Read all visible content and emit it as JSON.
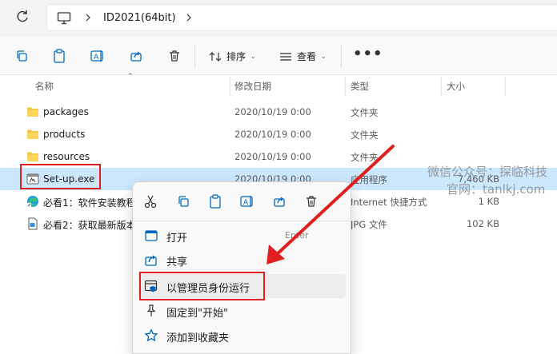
{
  "address": {
    "refresh_icon": "refresh-icon",
    "pc_icon": "this-pc-icon",
    "path": "ID2021(64bit)"
  },
  "toolbar": {
    "sort_label": "排序",
    "view_label": "查看",
    "more_label": "•••"
  },
  "columns": {
    "name": "名称",
    "date": "修改日期",
    "type": "类型",
    "size": "大小"
  },
  "files": [
    {
      "name": "packages",
      "date": "2020/10/19 0:00",
      "type": "文件夹",
      "size": "",
      "icon": "folder-icon"
    },
    {
      "name": "products",
      "date": "2020/10/19 0:00",
      "type": "文件夹",
      "size": "",
      "icon": "folder-icon"
    },
    {
      "name": "resources",
      "date": "2020/10/19 0:00",
      "type": "文件夹",
      "size": "",
      "icon": "folder-icon"
    },
    {
      "name": "Set-up.exe",
      "date": "2020/10/19 0:00",
      "type": "应用程序",
      "size": "7,460 KB",
      "icon": "exe-icon",
      "selected": true
    },
    {
      "name": "必看1：软件安装教程",
      "date": "",
      "type": "Internet 快捷方式",
      "size": "1 KB",
      "icon": "edge-icon"
    },
    {
      "name": "必看2：获取最新版本",
      "date": "",
      "type": "JPG 文件",
      "size": "102 KB",
      "icon": "image-file-icon"
    }
  ],
  "watermark": {
    "line1": "微信公众号：探临科技",
    "line2": "官网：tanlkj.com"
  },
  "context_menu": {
    "items": [
      {
        "label": "打开",
        "shortcut": "Enter",
        "icon": "open-icon"
      },
      {
        "label": "共享",
        "shortcut": "",
        "icon": "share-icon"
      },
      {
        "label": "以管理员身份运行",
        "shortcut": "",
        "icon": "run-as-admin-icon"
      },
      {
        "label": "固定到\"开始\"",
        "shortcut": "",
        "icon": "pin-icon"
      },
      {
        "label": "添加到收藏夹",
        "shortcut": "",
        "icon": "star-icon"
      }
    ]
  },
  "colors": {
    "selection": "#cce8ff",
    "annotation": "#e02020",
    "accent": "#0067c0"
  }
}
